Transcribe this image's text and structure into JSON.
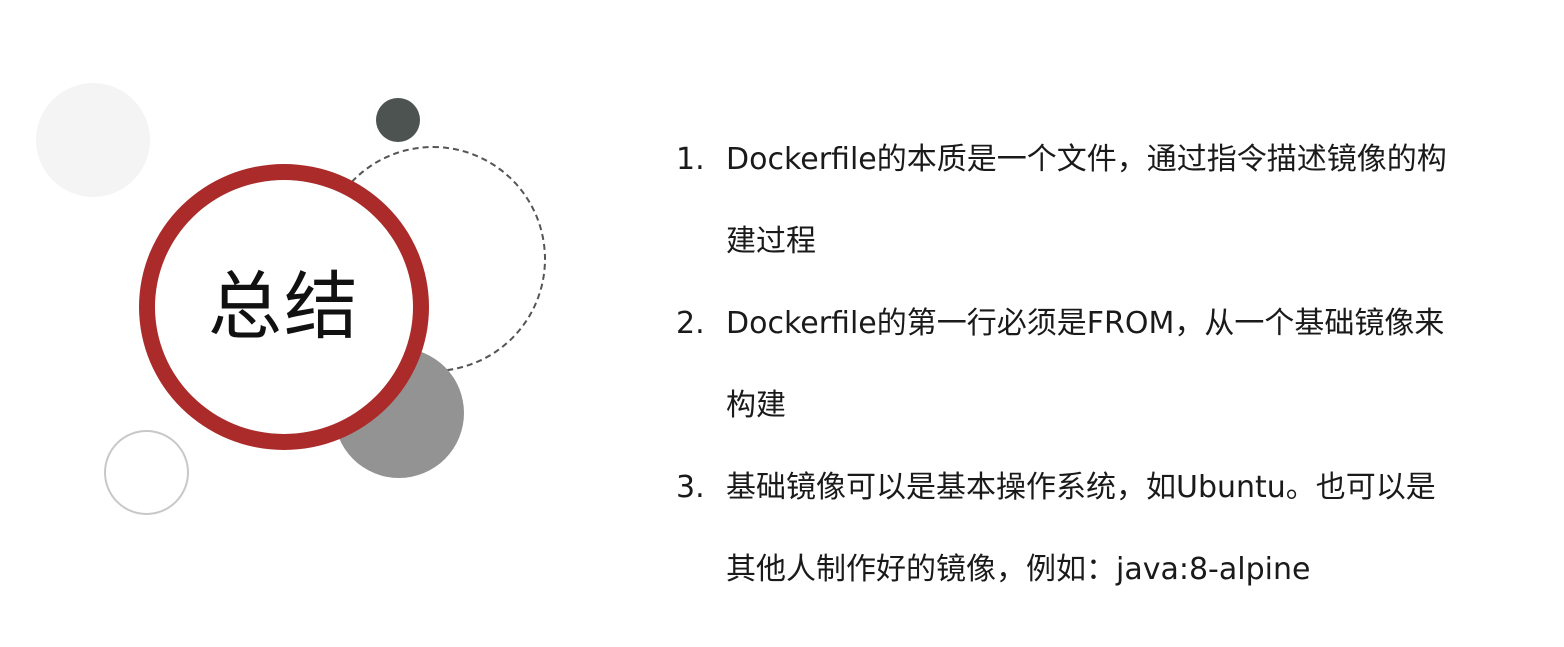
{
  "slide": {
    "title": "总结",
    "colors": {
      "accent_ring": "#ab2b2b",
      "dark_dot": "#4d5350",
      "gray_dot": "#939393",
      "light_dot": "#f4f4f4"
    },
    "items": [
      {
        "number": "1.",
        "text": "Dockerfile的本质是一个文件，通过指令描述镜像的构建过程"
      },
      {
        "number": "2.",
        "text": "Dockerfile的第一行必须是FROM，从一个基础镜像来构建"
      },
      {
        "number": "3.",
        "text": "基础镜像可以是基本操作系统，如Ubuntu。也可以是其他人制作好的镜像，例如：java:8-alpine"
      }
    ]
  }
}
